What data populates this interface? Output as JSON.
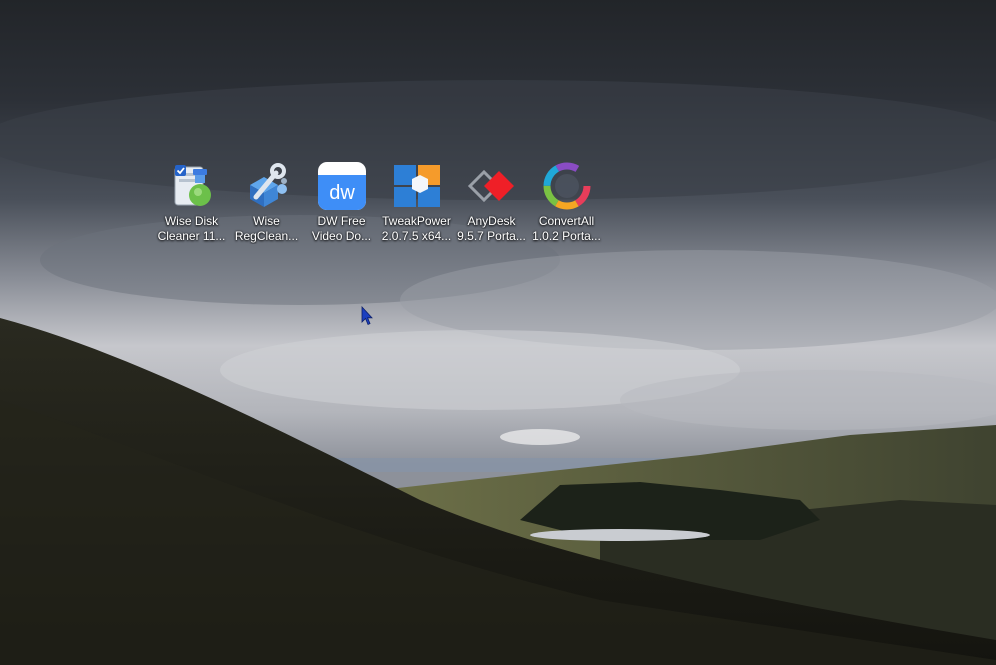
{
  "desktop": {
    "icons": [
      {
        "line1": "Wise Disk",
        "line2": "Cleaner 11...",
        "icon": "wise-disk-cleaner-icon"
      },
      {
        "line1": "Wise",
        "line2": "RegClean...",
        "icon": "wise-regcleaner-icon"
      },
      {
        "line1": "DW Free",
        "line2": "Video Do...",
        "icon": "dw-free-video-downloader-icon",
        "glyph_text": "dw"
      },
      {
        "line1": "TweakPower",
        "line2": "2.0.7.5 x64...",
        "icon": "tweakpower-icon"
      },
      {
        "line1": "AnyDesk",
        "line2": "9.5.7 Porta...",
        "icon": "anydesk-icon"
      },
      {
        "line1": "ConvertAll",
        "line2": "1.0.2 Porta...",
        "icon": "convertall-icon"
      }
    ]
  },
  "colors": {
    "label_text": "#ffffff",
    "dw_blue": "#3e8ef7",
    "anydesk_red": "#ef1f27",
    "tweakpower_blue": "#2d7fd6",
    "tweakpower_orange": "#f59b2b"
  }
}
